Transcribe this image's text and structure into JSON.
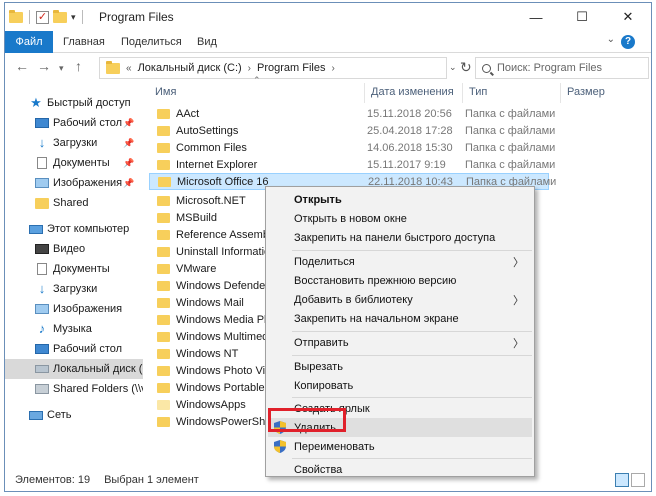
{
  "window": {
    "title": "Program Files"
  },
  "controls": {
    "minimize": "—",
    "maximize": "☐",
    "close": "✕"
  },
  "ribbon": {
    "tabs": [
      "Файл",
      "Главная",
      "Поделиться",
      "Вид"
    ],
    "help": "?"
  },
  "address": {
    "overflow": "«",
    "crumbs": [
      "Локальный диск (C:)",
      "Program Files"
    ],
    "search_placeholder": "Поиск: Program Files"
  },
  "nav": {
    "quick_access": "Быстрый доступ",
    "quick_items": [
      "Рабочий стол",
      "Загрузки",
      "Документы",
      "Изображения",
      "Shared"
    ],
    "this_pc": "Этот компьютер",
    "pc_items": [
      "Видео",
      "Документы",
      "Загрузки",
      "Изображения",
      "Музыка",
      "Рабочий стол",
      "Локальный диск (C:)",
      "Shared Folders (\\\\vmware-host) (Z:)"
    ],
    "network": "Сеть"
  },
  "columns": {
    "name": "Имя",
    "date": "Дата изменения",
    "type": "Тип",
    "size": "Размер"
  },
  "files": [
    {
      "name": "AAct",
      "date": "15.11.2018 20:56",
      "type": "Папка с файлами"
    },
    {
      "name": "AutoSettings",
      "date": "25.04.2018 17:28",
      "type": "Папка с файлами"
    },
    {
      "name": "Common Files",
      "date": "14.06.2018 15:30",
      "type": "Папка с файлами"
    },
    {
      "name": "Internet Explorer",
      "date": "15.11.2017 9:19",
      "type": "Папка с файлами"
    },
    {
      "name": "Microsoft Office 16",
      "date": "22.11.2018 10:43",
      "type": "Папка с файлами"
    },
    {
      "name": "Microsoft.NET",
      "date": "",
      "type": ""
    },
    {
      "name": "MSBuild",
      "date": "",
      "type": ""
    },
    {
      "name": "Reference Assemblies",
      "date": "",
      "type": ""
    },
    {
      "name": "Uninstall Information",
      "date": "",
      "type": ""
    },
    {
      "name": "VMware",
      "date": "",
      "type": ""
    },
    {
      "name": "Windows Defender",
      "date": "",
      "type": ""
    },
    {
      "name": "Windows Mail",
      "date": "",
      "type": ""
    },
    {
      "name": "Windows Media Player",
      "date": "",
      "type": ""
    },
    {
      "name": "Windows Multimedia Platform",
      "date": "",
      "type": ""
    },
    {
      "name": "Windows NT",
      "date": "",
      "type": ""
    },
    {
      "name": "Windows Photo Viewer",
      "date": "",
      "type": ""
    },
    {
      "name": "Windows Portable Devices",
      "date": "",
      "type": ""
    },
    {
      "name": "WindowsApps",
      "date": "",
      "type": ""
    },
    {
      "name": "WindowsPowerShell",
      "date": "",
      "type": ""
    }
  ],
  "menu": {
    "open": "Открыть",
    "open_new": "Открыть в новом окне",
    "pin_quick": "Закрепить на панели быстрого доступа",
    "share": "Поделиться",
    "restore": "Восстановить прежнюю версию",
    "add_library": "Добавить в библиотеку",
    "pin_start": "Закрепить на начальном экране",
    "send_to": "Отправить",
    "cut": "Вырезать",
    "copy": "Копировать",
    "shortcut": "Создать ярлык",
    "delete": "Удалить",
    "rename": "Переименовать",
    "properties": "Свойства",
    "arrow": "〉"
  },
  "status": {
    "count": "Элементов: 19",
    "selected": "Выбран 1 элемент"
  }
}
